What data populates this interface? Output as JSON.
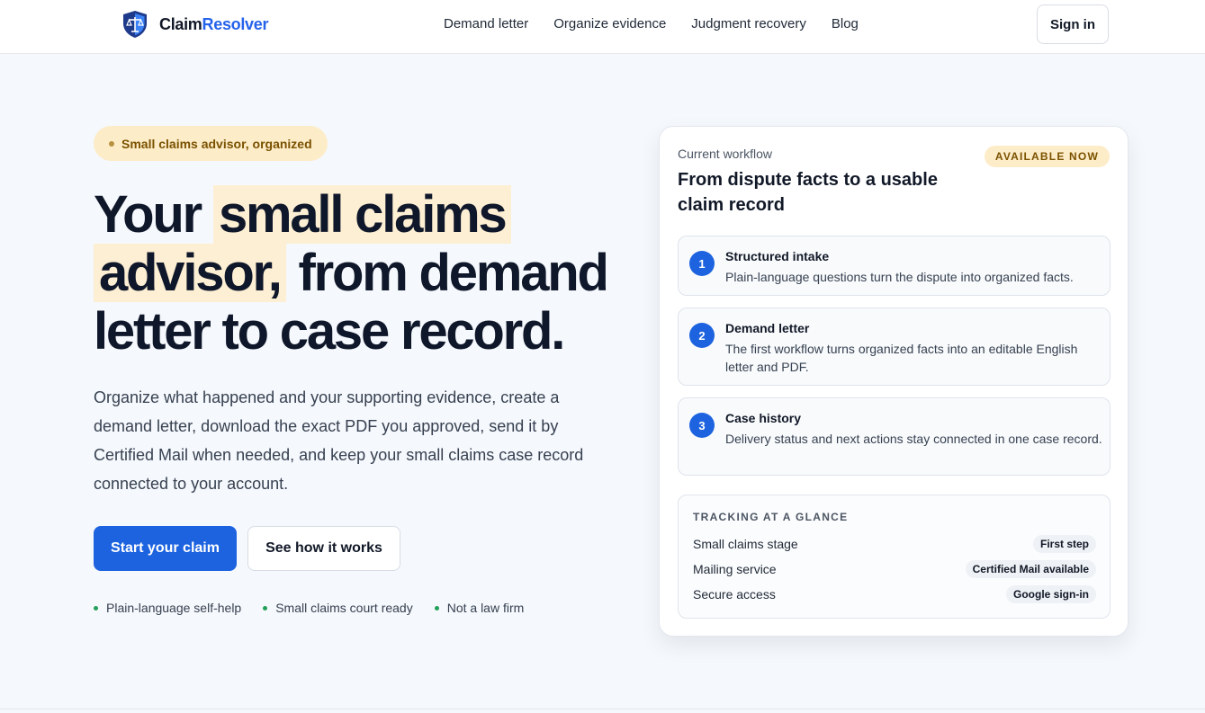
{
  "header": {
    "brand_part1": "Claim",
    "brand_part2": "Resolver",
    "nav": [
      {
        "label": "Demand letter"
      },
      {
        "label": "Organize evidence"
      },
      {
        "label": "Judgment recovery"
      },
      {
        "label": "Blog"
      }
    ],
    "signin_label": "Sign in"
  },
  "hero": {
    "pill": "Small claims advisor, organized",
    "title_1": "Your ",
    "title_hl1": "small claims",
    "title_hl2": "advisor,",
    "title_2": " from demand letter to case record.",
    "lead": "Organize what happened and your supporting evidence, create a demand letter, download the exact PDF you approved, send it by Certified Mail when needed, and keep your small claims case record connected to your account.",
    "primary_label": "Start your claim",
    "secondary_label": "See how it works",
    "trust": [
      "Plain-language self-help",
      "Small claims court ready",
      "Not a law firm"
    ]
  },
  "card": {
    "kicker": "Current workflow",
    "title": "From dispute facts to a usable claim record",
    "badge": "AVAILABLE NOW",
    "steps": [
      {
        "num": "1",
        "title": "Structured intake",
        "desc": "Plain-language questions turn the dispute into organized facts."
      },
      {
        "num": "2",
        "title": "Demand letter",
        "desc": "The first workflow turns organized facts into an editable English letter and PDF."
      },
      {
        "num": "3",
        "title": "Case history",
        "desc": "Delivery status and next actions stay connected in one case record."
      }
    ],
    "tracking": {
      "heading": "TRACKING AT A GLANCE",
      "rows": [
        {
          "label": "Small claims stage",
          "value": "First step"
        },
        {
          "label": "Mailing service",
          "value": "Certified Mail available"
        },
        {
          "label": "Secure access",
          "value": "Google sign-in"
        }
      ]
    }
  },
  "colors": {
    "accent": "#1d63e0",
    "highlight": "#fdefd3",
    "pill_bg": "#fdecc8",
    "trust_dot": "#22a05a"
  },
  "icons": {
    "logo": "shield-scales-icon"
  }
}
